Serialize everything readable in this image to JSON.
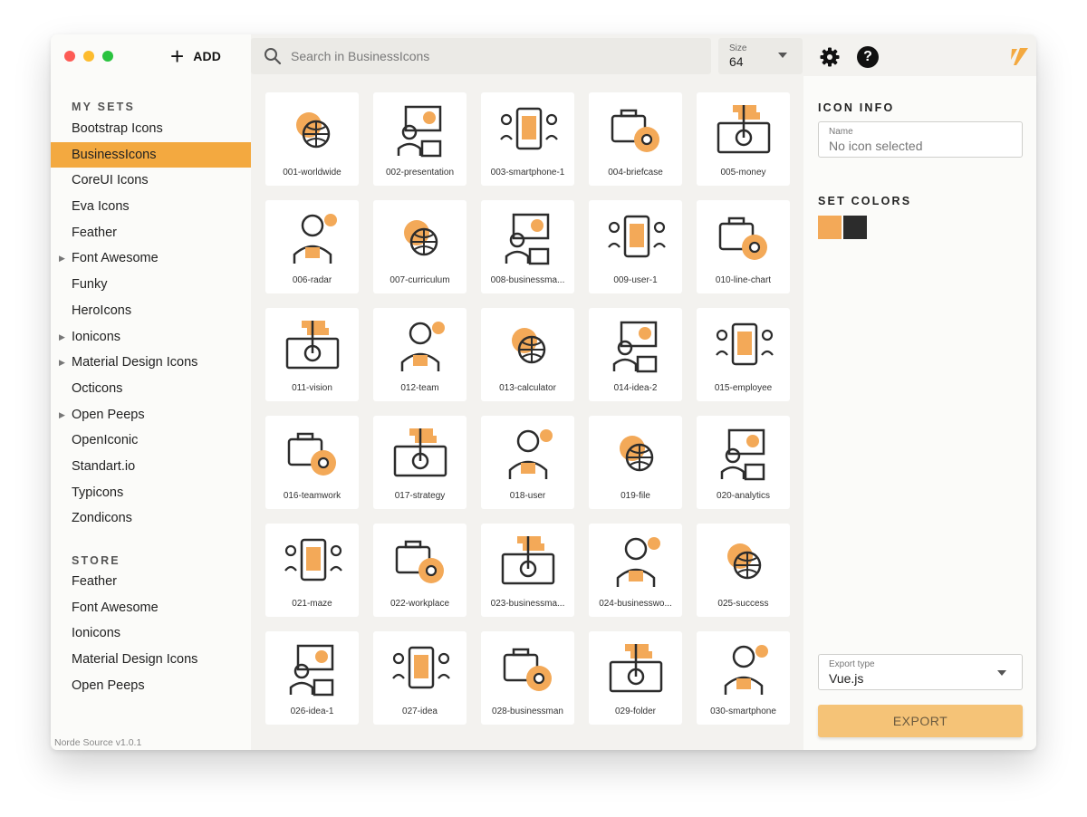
{
  "window": {
    "add_label": "ADD",
    "version": "Norde Source v1.0.1"
  },
  "sidebar": {
    "my_sets_title": "MY SETS",
    "my_sets": [
      {
        "label": "Bootstrap Icons",
        "expandable": false,
        "active": false
      },
      {
        "label": "BusinessIcons",
        "expandable": false,
        "active": true
      },
      {
        "label": "CoreUI Icons",
        "expandable": false,
        "active": false
      },
      {
        "label": "Eva Icons",
        "expandable": false,
        "active": false
      },
      {
        "label": "Feather",
        "expandable": false,
        "active": false
      },
      {
        "label": "Font Awesome",
        "expandable": true,
        "active": false
      },
      {
        "label": "Funky",
        "expandable": false,
        "active": false
      },
      {
        "label": "HeroIcons",
        "expandable": false,
        "active": false
      },
      {
        "label": "Ionicons",
        "expandable": true,
        "active": false
      },
      {
        "label": "Material Design Icons",
        "expandable": true,
        "active": false
      },
      {
        "label": "Octicons",
        "expandable": false,
        "active": false
      },
      {
        "label": "Open Peeps",
        "expandable": true,
        "active": false
      },
      {
        "label": "OpenIconic",
        "expandable": false,
        "active": false
      },
      {
        "label": "Standart.io",
        "expandable": false,
        "active": false
      },
      {
        "label": "Typicons",
        "expandable": false,
        "active": false
      },
      {
        "label": "Zondicons",
        "expandable": false,
        "active": false
      }
    ],
    "store_title": "STORE",
    "store": [
      {
        "label": "Feather"
      },
      {
        "label": "Font Awesome"
      },
      {
        "label": "Ionicons"
      },
      {
        "label": "Material Design Icons"
      },
      {
        "label": "Open Peeps"
      }
    ]
  },
  "search": {
    "placeholder": "Search in BusinessIcons",
    "value": ""
  },
  "size": {
    "label": "Size",
    "value": "64"
  },
  "icons": [
    {
      "name": "001-worldwide",
      "icon": "worldwide-icon"
    },
    {
      "name": "002-presentation",
      "icon": "presentation-icon"
    },
    {
      "name": "003-smartphone-1",
      "icon": "smartphone-icon"
    },
    {
      "name": "004-briefcase",
      "icon": "briefcase-icon"
    },
    {
      "name": "005-money",
      "icon": "money-icon"
    },
    {
      "name": "006-radar",
      "icon": "radar-icon"
    },
    {
      "name": "007-curriculum",
      "icon": "curriculum-icon"
    },
    {
      "name": "008-businessma...",
      "icon": "businessman-growth-icon"
    },
    {
      "name": "009-user-1",
      "icon": "user-network-icon"
    },
    {
      "name": "010-line-chart",
      "icon": "line-chart-icon"
    },
    {
      "name": "011-vision",
      "icon": "vision-icon"
    },
    {
      "name": "012-team",
      "icon": "team-icon"
    },
    {
      "name": "013-calculator",
      "icon": "calculator-icon"
    },
    {
      "name": "014-idea-2",
      "icon": "idea-network-icon"
    },
    {
      "name": "015-employee",
      "icon": "employee-icon"
    },
    {
      "name": "016-teamwork",
      "icon": "teamwork-icon"
    },
    {
      "name": "017-strategy",
      "icon": "strategy-icon"
    },
    {
      "name": "018-user",
      "icon": "user-globe-icon"
    },
    {
      "name": "019-file",
      "icon": "file-icon"
    },
    {
      "name": "020-analytics",
      "icon": "analytics-icon"
    },
    {
      "name": "021-maze",
      "icon": "maze-icon"
    },
    {
      "name": "022-workplace",
      "icon": "workplace-icon"
    },
    {
      "name": "023-businessma...",
      "icon": "businessman-target-icon"
    },
    {
      "name": "024-businesswo...",
      "icon": "businesswoman-icon"
    },
    {
      "name": "025-success",
      "icon": "success-icon"
    },
    {
      "name": "026-idea-1",
      "icon": "idea-pie-icon"
    },
    {
      "name": "027-idea",
      "icon": "idea-gear-icon"
    },
    {
      "name": "028-businessman",
      "icon": "businessman-icon"
    },
    {
      "name": "029-folder",
      "icon": "folder-icon"
    },
    {
      "name": "030-smartphone",
      "icon": "smartphone-payment-icon"
    }
  ],
  "panel": {
    "icon_info_title": "ICON INFO",
    "name_label": "Name",
    "name_value": "No icon selected",
    "set_colors_title": "SET COLORS",
    "colors": [
      "#f3a958",
      "#2c2c2c"
    ],
    "export_type_label": "Export type",
    "export_type_value": "Vue.js",
    "export_label": "EXPORT"
  },
  "accent": "#f3a940"
}
